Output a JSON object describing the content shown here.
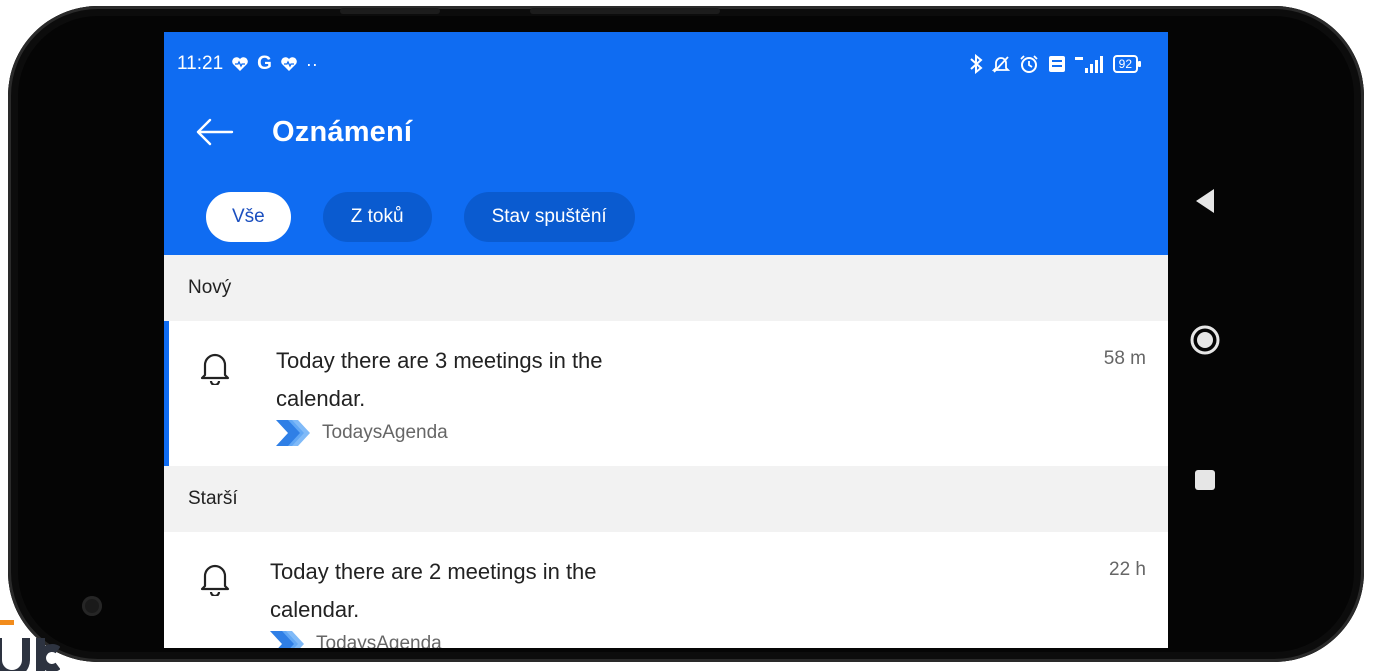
{
  "status_bar": {
    "time": "11:21",
    "left_icons": [
      "heart-icon",
      "google-g-icon",
      "heart-icon",
      "dots-icon"
    ],
    "g_letter": "G",
    "dots": "··",
    "right_icons": [
      "bluetooth-icon",
      "bell-off-icon",
      "alarm-icon",
      "volte-icon",
      "signal-5g-icon"
    ],
    "battery": "92"
  },
  "header": {
    "title": "Oznámení",
    "tabs": [
      {
        "label": "Vše",
        "active": true
      },
      {
        "label": "Z toků",
        "active": false
      },
      {
        "label": "Stav spuštění",
        "active": false
      }
    ]
  },
  "sections": [
    {
      "label": "Nový",
      "items": [
        {
          "text": "Today there are 3 meetings in the calendar.",
          "source": "TodaysAgenda",
          "time": "58 m",
          "unread": true
        }
      ]
    },
    {
      "label": "Starší",
      "items": [
        {
          "text": "Today there are 2 meetings in the calendar.",
          "source": "TodaysAgenda",
          "time": "22 h",
          "unread": false
        }
      ]
    }
  ],
  "colors": {
    "header_blue": "#0f6cf2",
    "tab_bg": "#0a5bd0",
    "active_tab_text": "#1b4fbf",
    "section_bg": "#f2f2f2"
  },
  "nav_bar": [
    "back-triangle-icon",
    "home-circle-icon",
    "recent-square-icon"
  ]
}
